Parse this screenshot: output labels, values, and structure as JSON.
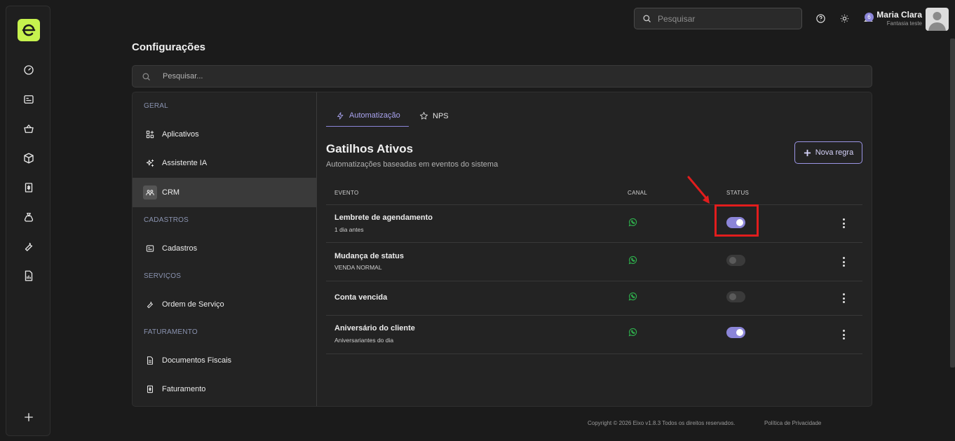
{
  "header": {
    "search_placeholder": "Pesquisar",
    "notification_count": "6",
    "user_name": "Maria Clara",
    "user_company": "Fantasia teste"
  },
  "rail": {
    "icons": [
      "dashboard-icon",
      "id-card-icon",
      "basket-icon",
      "box-icon",
      "invoice-icon",
      "money-bag-icon",
      "wrench-icon",
      "report-icon",
      "plus-icon"
    ]
  },
  "page": {
    "title": "Configurações",
    "search_placeholder": "Pesquisar..."
  },
  "nav": {
    "sections": {
      "geral": "GERAL",
      "cadastros": "CADASTROS",
      "servicos": "SERVIÇOS",
      "faturamento": "FATURAMENTO"
    },
    "items": {
      "aplicativos": "Aplicativos",
      "assistente": "Assistente IA",
      "crm": "CRM",
      "cadastros": "Cadastros",
      "ordem": "Ordem de Serviço",
      "documentos": "Documentos Fiscais",
      "faturamento": "Faturamento"
    },
    "active": "crm"
  },
  "tabs": {
    "automacao": "Automatização",
    "nps": "NPS",
    "active": "automacao"
  },
  "section": {
    "title": "Gatilhos Ativos",
    "subtitle": "Automatizações baseadas em eventos do sistema",
    "new_rule_label": "Nova regra"
  },
  "table": {
    "headers": {
      "evento": "EVENTO",
      "canal": "CANAL",
      "status": "STATUS"
    },
    "rows": [
      {
        "name": "Lembrete de agendamento",
        "sub": "1 dia antes",
        "channel": "whatsapp",
        "status": true
      },
      {
        "name": "Mudança de status",
        "sub": "VENDA NORMAL",
        "channel": "whatsapp",
        "status": false
      },
      {
        "name": "Conta vencida",
        "sub": "",
        "channel": "whatsapp",
        "status": false
      },
      {
        "name": "Aniversário do cliente",
        "sub": "Aniversariantes do dia",
        "channel": "whatsapp",
        "status": true
      }
    ]
  },
  "annotation": {
    "color": "#e11d1d"
  },
  "colors": {
    "accent": "#8b85d8",
    "brand": "#c6f24e",
    "whatsapp": "#2fb84f"
  },
  "footer": {
    "copyright": "Copyright © 2026 Eixo v1.8.3 Todos os direitos reservados.",
    "privacy": "Política de Privacidade"
  }
}
